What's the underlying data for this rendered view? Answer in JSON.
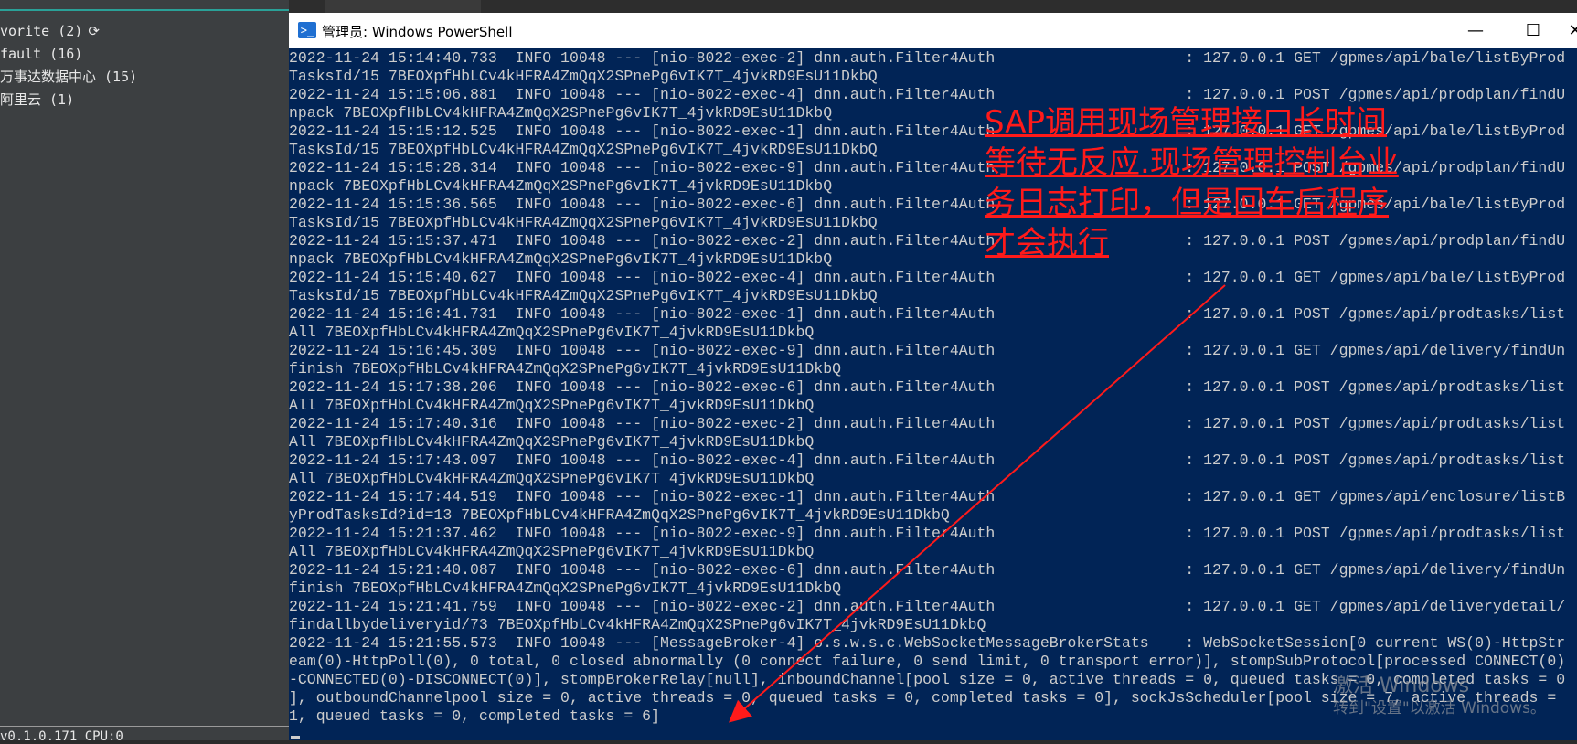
{
  "sidebar": {
    "items": [
      {
        "label": "vorite (2)"
      },
      {
        "label": "fault (16)"
      },
      {
        "label": "万事达数据中心 (15)"
      },
      {
        "label": "阿里云 (1)"
      }
    ],
    "status_text": "v0.1.0.171 CPU:0"
  },
  "window": {
    "title": "管理员: Windows PowerShell",
    "minimize": "—",
    "maximize": "☐",
    "close": "✕"
  },
  "console": {
    "lines": [
      "2022-11-24 15:14:40.733  INFO 10048 --- [nio-8022-exec-2] dnn.auth.Filter4Auth                     : 127.0.0.1 GET /gpmes/api/bale/listByProd",
      "TasksId/15 7BEOXpfHbLCv4kHFRA4ZmQqX2SPnePg6vIK7T_4jvkRD9EsU11DkbQ",
      "2022-11-24 15:15:06.881  INFO 10048 --- [nio-8022-exec-4] dnn.auth.Filter4Auth                     : 127.0.0.1 POST /gpmes/api/prodplan/findU",
      "npack 7BEOXpfHbLCv4kHFRA4ZmQqX2SPnePg6vIK7T_4jvkRD9EsU11DkbQ",
      "2022-11-24 15:15:12.525  INFO 10048 --- [nio-8022-exec-1] dnn.auth.Filter4Auth                     : 127.0.0.1 GET /gpmes/api/bale/listByProd",
      "TasksId/15 7BEOXpfHbLCv4kHFRA4ZmQqX2SPnePg6vIK7T_4jvkRD9EsU11DkbQ",
      "2022-11-24 15:15:28.314  INFO 10048 --- [nio-8022-exec-9] dnn.auth.Filter4Auth                     : 127.0.0.1 POST /gpmes/api/prodplan/findU",
      "npack 7BEOXpfHbLCv4kHFRA4ZmQqX2SPnePg6vIK7T_4jvkRD9EsU11DkbQ",
      "2022-11-24 15:15:36.565  INFO 10048 --- [nio-8022-exec-6] dnn.auth.Filter4Auth                     : 127.0.0.1 GET /gpmes/api/bale/listByProd",
      "TasksId/15 7BEOXpfHbLCv4kHFRA4ZmQqX2SPnePg6vIK7T_4jvkRD9EsU11DkbQ",
      "2022-11-24 15:15:37.471  INFO 10048 --- [nio-8022-exec-2] dnn.auth.Filter4Auth                     : 127.0.0.1 POST /gpmes/api/prodplan/findU",
      "npack 7BEOXpfHbLCv4kHFRA4ZmQqX2SPnePg6vIK7T_4jvkRD9EsU11DkbQ",
      "2022-11-24 15:15:40.627  INFO 10048 --- [nio-8022-exec-4] dnn.auth.Filter4Auth                     : 127.0.0.1 GET /gpmes/api/bale/listByProd",
      "TasksId/15 7BEOXpfHbLCv4kHFRA4ZmQqX2SPnePg6vIK7T_4jvkRD9EsU11DkbQ",
      "2022-11-24 15:16:41.731  INFO 10048 --- [nio-8022-exec-1] dnn.auth.Filter4Auth                     : 127.0.0.1 POST /gpmes/api/prodtasks/list",
      "All 7BEOXpfHbLCv4kHFRA4ZmQqX2SPnePg6vIK7T_4jvkRD9EsU11DkbQ",
      "2022-11-24 15:16:45.309  INFO 10048 --- [nio-8022-exec-9] dnn.auth.Filter4Auth                     : 127.0.0.1 GET /gpmes/api/delivery/findUn",
      "finish 7BEOXpfHbLCv4kHFRA4ZmQqX2SPnePg6vIK7T_4jvkRD9EsU11DkbQ",
      "2022-11-24 15:17:38.206  INFO 10048 --- [nio-8022-exec-6] dnn.auth.Filter4Auth                     : 127.0.0.1 POST /gpmes/api/prodtasks/list",
      "All 7BEOXpfHbLCv4kHFRA4ZmQqX2SPnePg6vIK7T_4jvkRD9EsU11DkbQ",
      "2022-11-24 15:17:40.316  INFO 10048 --- [nio-8022-exec-2] dnn.auth.Filter4Auth                     : 127.0.0.1 POST /gpmes/api/prodtasks/list",
      "All 7BEOXpfHbLCv4kHFRA4ZmQqX2SPnePg6vIK7T_4jvkRD9EsU11DkbQ",
      "2022-11-24 15:17:43.097  INFO 10048 --- [nio-8022-exec-4] dnn.auth.Filter4Auth                     : 127.0.0.1 POST /gpmes/api/prodtasks/list",
      "All 7BEOXpfHbLCv4kHFRA4ZmQqX2SPnePg6vIK7T_4jvkRD9EsU11DkbQ",
      "2022-11-24 15:17:44.519  INFO 10048 --- [nio-8022-exec-1] dnn.auth.Filter4Auth                     : 127.0.0.1 GET /gpmes/api/enclosure/listB",
      "yProdTasksId?id=13 7BEOXpfHbLCv4kHFRA4ZmQqX2SPnePg6vIK7T_4jvkRD9EsU11DkbQ",
      "2022-11-24 15:21:37.462  INFO 10048 --- [nio-8022-exec-9] dnn.auth.Filter4Auth                     : 127.0.0.1 POST /gpmes/api/prodtasks/list",
      "All 7BEOXpfHbLCv4kHFRA4ZmQqX2SPnePg6vIK7T_4jvkRD9EsU11DkbQ",
      "2022-11-24 15:21:40.087  INFO 10048 --- [nio-8022-exec-6] dnn.auth.Filter4Auth                     : 127.0.0.1 GET /gpmes/api/delivery/findUn",
      "finish 7BEOXpfHbLCv4kHFRA4ZmQqX2SPnePg6vIK7T_4jvkRD9EsU11DkbQ",
      "2022-11-24 15:21:41.759  INFO 10048 --- [nio-8022-exec-2] dnn.auth.Filter4Auth                     : 127.0.0.1 GET /gpmes/api/deliverydetail/",
      "findallbydeliveryid/73 7BEOXpfHbLCv4kHFRA4ZmQqX2SPnePg6vIK7T_4jvkRD9EsU11DkbQ",
      "2022-11-24 15:21:55.573  INFO 10048 --- [MessageBroker-4] o.s.w.s.c.WebSocketMessageBrokerStats    : WebSocketSession[0 current WS(0)-HttpStr",
      "eam(0)-HttpPoll(0), 0 total, 0 closed abnormally (0 connect failure, 0 send limit, 0 transport error)], stompSubProtocol[processed CONNECT(0)",
      "-CONNECTED(0)-DISCONNECT(0)], stompBrokerRelay[null], inboundChannel[pool size = 0, active threads = 0, queued tasks = 0, completed tasks = 0",
      "], outboundChannelpool size = 0, active threads = 0, queued tasks = 0, completed tasks = 0], sockJsScheduler[pool size = 7, active threads =",
      "1, queued tasks = 0, completed tasks = 6]"
    ]
  },
  "annotation": {
    "text": "SAP调用现场管理接口长时间等待无反应.现场管理控制台业务日志打印，但是回车后程序才会执行",
    "color": "#ff1a1a"
  },
  "watermark": {
    "line1": "激活 Windows",
    "line2": "转到\"设置\"以激活 Windows。"
  },
  "colors": {
    "console_bg": "#012456",
    "console_fg": "#cccccc",
    "accent": "#2aa198"
  }
}
